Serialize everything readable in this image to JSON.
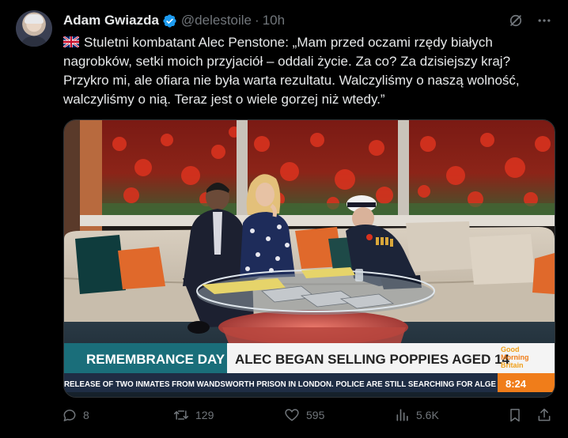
{
  "post": {
    "author_name": "Adam Gwiazda",
    "handle": "@delestoile",
    "separator": "·",
    "time": "10h",
    "flag_icon": "uk-flag-icon",
    "text": "Stuletni kombatant Alec Penstone: „Mam przed oczami rzędy białych nagrobków, setki moich przyjaciół – oddali życie. Za co? Za dzisiejszy kraj? Przykro mi, ale ofiara nie była warta rezultatu. Walczyliśmy o naszą wolność, walczyliśmy o nią. Teraz jest o wiele gorzej niż wtedy.”"
  },
  "media": {
    "lower_third_left": "REMEMBRANCE DAY",
    "lower_third_right": "ALEC BEGAN SELLING POPPIES AGED 14",
    "logo_line1": "Good",
    "logo_line2": "Morning",
    "logo_line3": "Britain",
    "ticker": "RELEASE OF TWO INMATES FROM WANDSWORTH PRISON IN LONDON. POLICE ARE STILL SEARCHING FOR ALGE",
    "clock": "8:24"
  },
  "stats": {
    "replies": "8",
    "reposts": "129",
    "likes": "595",
    "views": "5.6K"
  },
  "colors": {
    "background": "#000000",
    "text": "#e7e9ea",
    "muted": "#71767b",
    "verified": "#1d9bf0",
    "ticker_orange": "#f07d1a",
    "lower_third_teal": "#1a6e7a"
  }
}
